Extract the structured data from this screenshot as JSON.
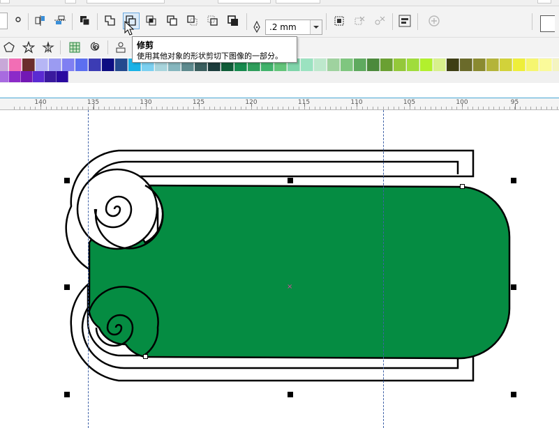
{
  "property_bar": {
    "buttons": [
      {
        "name": "node-tool-icon-button",
        "active": false
      },
      {
        "name": "align-objects-button",
        "active": false
      },
      {
        "name": "arrange-objects-button",
        "active": false
      },
      {
        "name": "combine-button",
        "active": false
      },
      {
        "name": "weld-button",
        "active": false
      },
      {
        "name": "trim-button",
        "active": true
      },
      {
        "name": "intersect-button",
        "active": false
      },
      {
        "name": "simplify-button",
        "active": false
      },
      {
        "name": "front-minus-back-button",
        "active": false
      },
      {
        "name": "back-minus-front-button",
        "active": false
      },
      {
        "name": "create-boundary-button",
        "active": false
      },
      {
        "name": "group-button",
        "active": false
      },
      {
        "name": "ungroup-button",
        "active": false
      },
      {
        "name": "ungroup-all-button",
        "active": false
      },
      {
        "name": "align-distribute-button",
        "active": false
      },
      {
        "name": "add-preset-button",
        "active": false
      }
    ],
    "outline_width": {
      "value": ".2 mm",
      "icon": "pen-nib-icon"
    }
  },
  "tooltip": {
    "title": "修剪",
    "description": "使用其他对象的形状剪切下图像的一部分。"
  },
  "toolbox": {
    "items": [
      "polygon-icon",
      "star-icon",
      "complex-star-icon",
      "graph-paper-icon",
      "spiral-icon",
      "basic-shapes-icon"
    ]
  },
  "palette": {
    "row1": [
      "#c8a8d8",
      "#f26eb5",
      "#6b2d2d",
      "#b6b6f5",
      "#9b9bf2",
      "#7f7ff2",
      "#5c6ff0",
      "#3c3cb4",
      "#0e0e82",
      "#244a8f",
      "#1ab2e6",
      "#7cd0f0",
      "#a8d4dc",
      "#86b6be",
      "#5e8a8e",
      "#3a5e5e",
      "#1c3c3c",
      "#0f5d38",
      "#178a4e",
      "#2f9e5c",
      "#41b36c",
      "#63c47a",
      "#7fd4aa",
      "#9be2c0",
      "#bde8cc",
      "#9fd29f",
      "#7fc67f",
      "#5faa5f",
      "#4c8a3c",
      "#6aa032",
      "#94c83a",
      "#a0dc3c",
      "#b2f02d",
      "#d8f08c",
      "#3e3e14",
      "#6a6a2a",
      "#8a8a30",
      "#b4b43a",
      "#d2d23a",
      "#eeee3a",
      "#f6f670",
      "#fafa9a",
      "#f4f4c0",
      "#9a5a2e",
      "#c86a34",
      "#de7a34",
      "#f0822a",
      "#f69a46",
      "#f4b45a",
      "#fad200"
    ],
    "row2": [
      "#a86be0",
      "#8c2ac8",
      "#7218b4",
      "#5a2ad2",
      "#3a1a9e",
      "#2a0aa0"
    ]
  },
  "ruler": {
    "labels": [
      "140",
      "135",
      "130",
      "125",
      "120",
      "115",
      "110",
      "105",
      "100",
      "95"
    ]
  },
  "canvas": {
    "shape_fill": "#058c42",
    "outline_color": "#000000"
  }
}
